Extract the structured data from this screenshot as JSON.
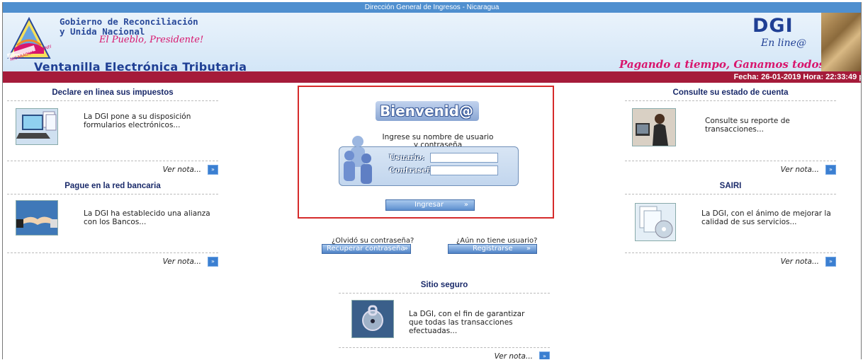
{
  "topbar": {
    "title": "Dirección General de Ingresos - Nicaragua"
  },
  "header": {
    "gov_line1": "Gobierno de Reconciliación",
    "gov_line2": "y Unida Nacional",
    "gov_slogan": "El Pueblo, Presidente!",
    "logo_text": "NICARAGUA TRIUNFA!",
    "app_title": "Ventanilla Electrónica Tributaria",
    "slogan_right": "Pagando a tiempo, Ganamos todos!!",
    "dgi_logo": "DGI",
    "dgi_sub": "En line@"
  },
  "datebar": {
    "text": "Fecha: 26-01-2019 Hora: 22:33:49 p"
  },
  "left_panels": [
    {
      "title": "Declare en linea sus impuestos",
      "text": "La DGI pone a su disposición formularios electrónicos...",
      "link": "Ver nota...",
      "icon": "laptop-forms-icon"
    },
    {
      "title": "Pague en la red bancaria",
      "text": "La DGI ha establecido una alianza con los Bancos...",
      "link": "Ver nota...",
      "icon": "handshake-icon"
    }
  ],
  "right_panels": [
    {
      "title": "Consulte su estado de cuenta",
      "text": "Consulte su reporte de transacciones...",
      "link": "Ver nota...",
      "icon": "person-computer-icon"
    },
    {
      "title": "SAIRI",
      "text": "La DGI, con el ánimo de mejorar la calidad de sus servicios...",
      "link": "Ver nota...",
      "icon": "cd-documents-icon"
    }
  ],
  "login": {
    "welcome": "Bienvenid@",
    "instructions": "Ingrese su nombre de usuario y contraseña",
    "user_label": "Usuario:",
    "password_label": "Contraseña:",
    "submit_label": "Ingresar",
    "arrow": "»"
  },
  "account": {
    "forgot_question": "¿Olvidó su contraseña?",
    "recover_label": "Recuperar contraseña",
    "no_user_question": "¿Aún no tiene usuario?",
    "register_label": "Registrarse"
  },
  "secure": {
    "title": "Sitio seguro",
    "text": "La DGI, con el fin de garantizar que todas las transacciones efectuadas...",
    "link": "Ver nota...",
    "icon": "secure-lock-icon"
  },
  "colors": {
    "topbar": "#4f8fcf",
    "datebar": "#a51b3a",
    "accent_pink": "#d8166d",
    "brand_blue": "#1f3f94",
    "login_border": "#d62b2b"
  }
}
